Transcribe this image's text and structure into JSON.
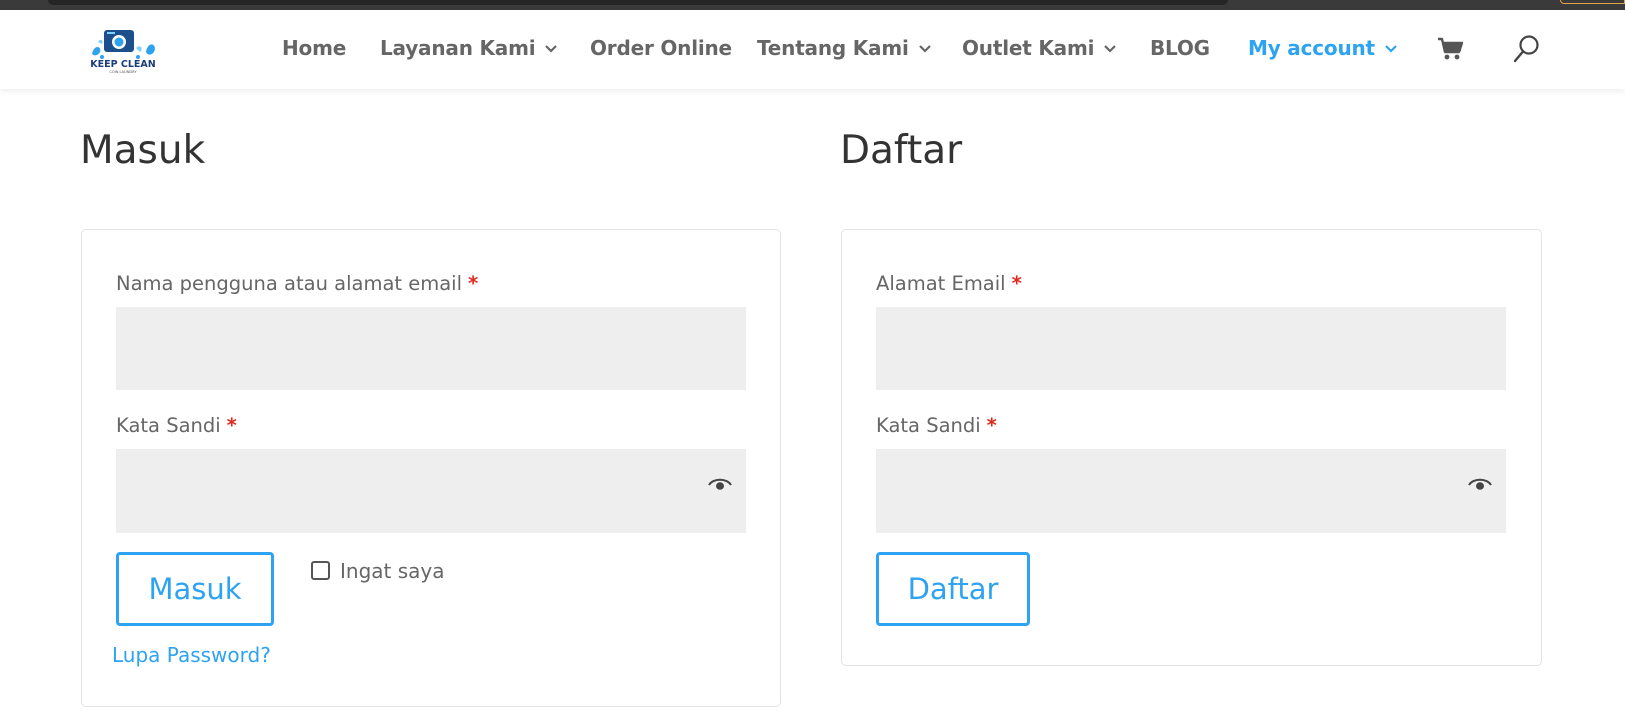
{
  "header": {
    "logo": {
      "text": "KEEP CLEAN",
      "subtext": "COIN LAUNDRY",
      "icon": "washing-machine-splash-logo"
    },
    "nav": [
      {
        "label": "Home",
        "has_dropdown": false,
        "active": false
      },
      {
        "label": "Layanan Kami",
        "has_dropdown": true,
        "active": false
      },
      {
        "label": "Order Online",
        "has_dropdown": false,
        "active": false
      },
      {
        "label": "Tentang Kami",
        "has_dropdown": true,
        "active": false
      },
      {
        "label": "Outlet Kami",
        "has_dropdown": true,
        "active": false
      },
      {
        "label": "BLOG",
        "has_dropdown": false,
        "active": false
      },
      {
        "label": "My account",
        "has_dropdown": true,
        "active": true
      }
    ],
    "icons": {
      "cart": "shopping-cart-icon",
      "search": "search-icon"
    }
  },
  "login": {
    "title": "Masuk",
    "username_label": "Nama pengguna atau alamat email",
    "username_value": "",
    "password_label": "Kata Sandi",
    "password_value": "",
    "required_mark": "*",
    "submit_label": "Masuk",
    "remember_label": "Ingat saya",
    "remember_checked": false,
    "forgot_label": "Lupa Password?"
  },
  "register": {
    "title": "Daftar",
    "email_label": "Alamat Email",
    "email_value": "",
    "password_label": "Kata Sandi",
    "password_value": "",
    "required_mark": "*",
    "submit_label": "Daftar"
  },
  "colors": {
    "accent": "#2ea3f2",
    "required": "#e02b20",
    "text": "#666666",
    "heading": "#333333",
    "input_bg": "#eeeeee",
    "card_border": "#e3e3e3"
  }
}
